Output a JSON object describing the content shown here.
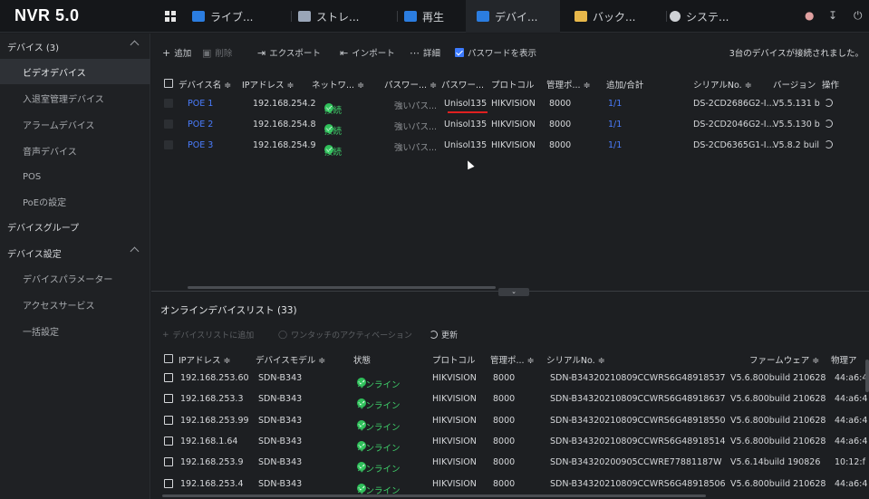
{
  "app": {
    "logo": "NVR 5.0"
  },
  "tabs": [
    {
      "label": "ライブ...",
      "color": "#2b7de0"
    },
    {
      "label": "ストレ...",
      "color": "#9aa6b8"
    },
    {
      "label": "再生",
      "color": "#2b7de0"
    },
    {
      "label": "デバイ...",
      "color": "#2b7de0"
    },
    {
      "label": "バック...",
      "color": "#e8b84a"
    },
    {
      "label": "システ...",
      "color": "#cfd2d6"
    }
  ],
  "sidebar": {
    "items": [
      {
        "label": "デバイス (3)"
      },
      {
        "label": "ビデオデバイス"
      },
      {
        "label": "入退室管理デバイス"
      },
      {
        "label": "アラームデバイス"
      },
      {
        "label": "音声デバイス"
      },
      {
        "label": "POS"
      },
      {
        "label": "PoEの設定"
      },
      {
        "label": "デバイスグループ"
      },
      {
        "label": "デバイス設定"
      },
      {
        "label": "デバイスパラメーター"
      },
      {
        "label": "アクセスサービス"
      },
      {
        "label": "一括設定"
      }
    ]
  },
  "toolbar": {
    "add": "追加",
    "delete": "削除",
    "export": "エクスポート",
    "import": "インポート",
    "detail": "詳細",
    "show_password": "パスワードを表示",
    "status": "3台のデバイスが接続されました。"
  },
  "device_table": {
    "headers": [
      "デバイス名 ≑",
      "IPアドレス ≑",
      "ネットワ... ≑",
      "パスワー... ≑",
      "パスワー...",
      "プロトコル",
      "管理ポ... ≑",
      "追加/合計",
      "シリアルNo. ≑",
      "バージョン",
      "操作"
    ],
    "rows": [
      {
        "name": "POE 1",
        "ip": "192.168.254.2",
        "status": "接続",
        "pw_strength": "強いパス...",
        "password": "Unisol135",
        "protocol": "HIKVISION",
        "port": "8000",
        "count": "1/1",
        "serial": "DS-2CD2686G2-I...",
        "version": "V5.5.131 b"
      },
      {
        "name": "POE 2",
        "ip": "192.168.254.8",
        "status": "接続",
        "pw_strength": "強いパス...",
        "password": "Unisol135",
        "protocol": "HIKVISION",
        "port": "8000",
        "count": "1/1",
        "serial": "DS-2CD2046G2-I...",
        "version": "V5.5.130 b"
      },
      {
        "name": "POE 3",
        "ip": "192.168.254.9",
        "status": "接続",
        "pw_strength": "強いパス...",
        "password": "Unisol135",
        "protocol": "HIKVISION",
        "port": "8000",
        "count": "1/1",
        "serial": "DS-2CD6365G1-I...",
        "version": "V5.8.2 buil"
      }
    ]
  },
  "online_list": {
    "title": "オンラインデバイスリスト (33)",
    "add_to_list": "デバイスリストに追加",
    "one_touch": "ワンタッチのアクティベーション",
    "refresh": "更新",
    "headers": [
      "IPアドレス ≑",
      "デバイスモデル ≑",
      "状態",
      "プロトコル",
      "管理ポ... ≑",
      "シリアルNo. ≑",
      "ファームウェア ≑",
      "物理ア"
    ],
    "rows": [
      {
        "ip": "192.168.253.60",
        "model": "SDN-B343",
        "state": "オンライン",
        "protocol": "HIKVISION",
        "port": "8000",
        "serial": "SDN-B34320210809CCWRS6G48918537",
        "firmware": "V5.6.800build 210628",
        "mac": "44:a6:4"
      },
      {
        "ip": "192.168.253.3",
        "model": "SDN-B343",
        "state": "オンライン",
        "protocol": "HIKVISION",
        "port": "8000",
        "serial": "SDN-B34320210809CCWRS6G48918637",
        "firmware": "V5.6.800build 210628",
        "mac": "44:a6:4"
      },
      {
        "ip": "192.168.253.99",
        "model": "SDN-B343",
        "state": "オンライン",
        "protocol": "HIKVISION",
        "port": "8000",
        "serial": "SDN-B34320210809CCWRS6G48918550",
        "firmware": "V5.6.800build 210628",
        "mac": "44:a6:4"
      },
      {
        "ip": "192.168.1.64",
        "model": "SDN-B343",
        "state": "オンライン",
        "protocol": "HIKVISION",
        "port": "8000",
        "serial": "SDN-B34320210809CCWRS6G48918514",
        "firmware": "V5.6.800build 210628",
        "mac": "44:a6:4"
      },
      {
        "ip": "192.168.253.9",
        "model": "SDN-B343",
        "state": "オンライン",
        "protocol": "HIKVISION",
        "port": "8000",
        "serial": "SDN-B34320200905CCWRE77881187W",
        "firmware": "V5.6.14build 190826",
        "mac": "10:12:f"
      },
      {
        "ip": "192.168.253.4",
        "model": "SDN-B343",
        "state": "オンライン",
        "protocol": "HIKVISION",
        "port": "8000",
        "serial": "SDN-B34320210809CCWRS6G48918506",
        "firmware": "V5.6.800build 210628",
        "mac": "44:a6:4"
      }
    ]
  },
  "colors": {
    "accent": "#3d7bff",
    "online": "#2fbf5a",
    "highlight": "#e02020"
  }
}
